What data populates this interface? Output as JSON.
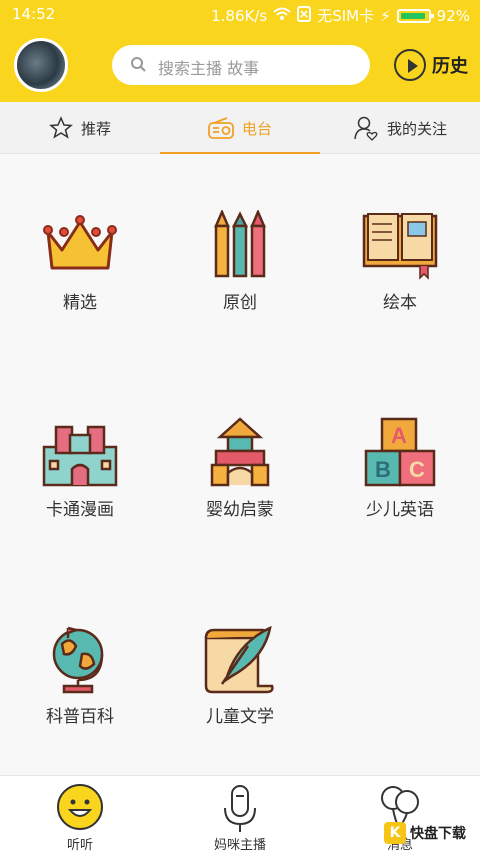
{
  "status_bar": {
    "time": "14:52",
    "network_speed": "1.86K/s",
    "sim": "无SIM卡",
    "battery": "92%"
  },
  "header": {
    "avatar_text": "",
    "search_placeholder": "搜索主播 故事",
    "history_label": "历史"
  },
  "tabs": [
    {
      "label": "推荐",
      "icon": "star-icon",
      "active": false
    },
    {
      "label": "电台",
      "icon": "radio-icon",
      "active": true
    },
    {
      "label": "我的关注",
      "icon": "user-heart-icon",
      "active": false
    }
  ],
  "categories": [
    {
      "label": "精选",
      "icon": "crown-icon"
    },
    {
      "label": "原创",
      "icon": "crayons-icon"
    },
    {
      "label": "绘本",
      "icon": "picture-book-icon"
    },
    {
      "label": "卡通漫画",
      "icon": "castle-icon"
    },
    {
      "label": "婴幼启蒙",
      "icon": "building-blocks-icon"
    },
    {
      "label": "少儿英语",
      "icon": "abc-blocks-icon"
    },
    {
      "label": "科普百科",
      "icon": "globe-icon"
    },
    {
      "label": "儿童文学",
      "icon": "quill-scroll-icon"
    }
  ],
  "bottom_nav": [
    {
      "label": "听听",
      "icon": "smile-face-icon",
      "active": true
    },
    {
      "label": "妈咪主播",
      "icon": "microphone-icon",
      "active": false
    },
    {
      "label": "消息",
      "icon": "balloons-icon",
      "active": false
    }
  ],
  "watermark": {
    "text": "快盘下载"
  },
  "colors": {
    "header_yellow": "#f9d51e",
    "accent_orange": "#f0a126",
    "text_dark": "#333333"
  }
}
